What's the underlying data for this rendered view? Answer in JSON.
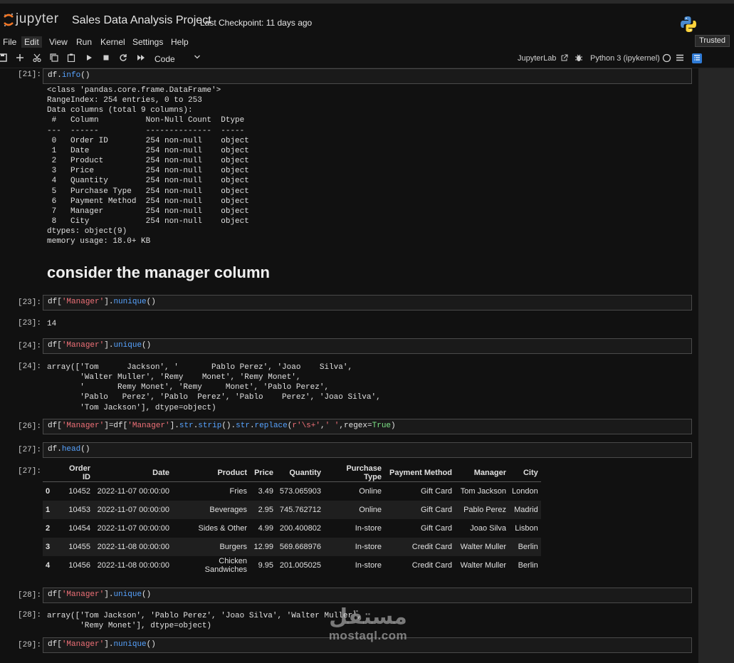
{
  "app": {
    "logo_text": "jupyter",
    "notebook_title": "Sales Data Analysis Project",
    "checkpoint": "Last Checkpoint: 11 days ago",
    "trusted": "Trusted"
  },
  "menu": [
    "File",
    "Edit",
    "View",
    "Run",
    "Kernel",
    "Settings",
    "Help"
  ],
  "toolbar": {
    "icons": [
      "save-icon",
      "add-cell-icon",
      "cut-icon",
      "copy-icon",
      "paste-icon",
      "run-icon",
      "stop-icon",
      "restart-icon",
      "run-all-icon"
    ],
    "cell_type": "Code",
    "jupyterlab_label": "JupyterLab",
    "kernel_name": "Python 3 (ipykernel)"
  },
  "cells": {
    "c21": {
      "prompt_in": "[21]:",
      "code": [
        {
          "t": "var",
          "v": "df."
        },
        {
          "t": "attr",
          "v": "info"
        },
        {
          "t": "var",
          "v": "()"
        }
      ],
      "output": "<class 'pandas.core.frame.DataFrame'>\nRangeIndex: 254 entries, 0 to 253\nData columns (total 9 columns):\n #   Column          Non-Null Count  Dtype \n---  ------          --------------  ----- \n 0   Order ID        254 non-null    object\n 1   Date            254 non-null    object\n 2   Product         254 non-null    object\n 3   Price           254 non-null    object\n 4   Quantity        254 non-null    object\n 5   Purchase Type   254 non-null    object\n 6   Payment Method  254 non-null    object\n 7   Manager         254 non-null    object\n 8   City            254 non-null    object\ndtypes: object(9)\nmemory usage: 18.0+ KB"
    },
    "markdown_heading": "consider the manager column",
    "c23": {
      "prompt_in": "[23]:",
      "prompt_out": "[23]:",
      "code": [
        {
          "t": "var",
          "v": "df["
        },
        {
          "t": "str",
          "v": "'Manager'"
        },
        {
          "t": "var",
          "v": "]."
        },
        {
          "t": "attr",
          "v": "nunique"
        },
        {
          "t": "var",
          "v": "()"
        }
      ],
      "output": "14"
    },
    "c24": {
      "prompt_in": "[24]:",
      "prompt_out": "[24]:",
      "code": [
        {
          "t": "var",
          "v": "df["
        },
        {
          "t": "str",
          "v": "'Manager'"
        },
        {
          "t": "var",
          "v": "]."
        },
        {
          "t": "attr",
          "v": "unique"
        },
        {
          "t": "var",
          "v": "()"
        }
      ],
      "output": "array(['Tom      Jackson', '       Pablo Perez', 'Joao    Silva',\n       'Walter Muller', 'Remy    Monet', 'Remy Monet',\n       '       Remy Monet', 'Remy     Monet', 'Pablo Perez',\n       'Pablo   Perez', 'Pablo  Perez', 'Pablo    Perez', 'Joao Silva',\n       'Tom Jackson'], dtype=object)"
    },
    "c26": {
      "prompt_in": "[26]:",
      "code": [
        {
          "t": "var",
          "v": "df["
        },
        {
          "t": "str",
          "v": "'Manager'"
        },
        {
          "t": "var",
          "v": "]=df["
        },
        {
          "t": "str",
          "v": "'Manager'"
        },
        {
          "t": "var",
          "v": "]."
        },
        {
          "t": "attr",
          "v": "str"
        },
        {
          "t": "var",
          "v": "."
        },
        {
          "t": "attr",
          "v": "strip"
        },
        {
          "t": "var",
          "v": "()."
        },
        {
          "t": "attr",
          "v": "str"
        },
        {
          "t": "var",
          "v": "."
        },
        {
          "t": "attr",
          "v": "replace"
        },
        {
          "t": "var",
          "v": "("
        },
        {
          "t": "str",
          "v": "r'\\s+'"
        },
        {
          "t": "var",
          "v": ","
        },
        {
          "t": "str",
          "v": "' '"
        },
        {
          "t": "var",
          "v": ",regex="
        },
        {
          "t": "kw",
          "v": "True"
        },
        {
          "t": "var",
          "v": ")"
        }
      ]
    },
    "c27": {
      "prompt_in": "[27]:",
      "prompt_out": "[27]:",
      "code": [
        {
          "t": "var",
          "v": "df."
        },
        {
          "t": "attr",
          "v": "head"
        },
        {
          "t": "var",
          "v": "()"
        }
      ],
      "table": {
        "columns": [
          "",
          "Order ID",
          "Date",
          "Product",
          "Price",
          "Quantity",
          "Purchase Type",
          "Payment Method",
          "Manager",
          "City"
        ],
        "rows": [
          [
            "0",
            "10452",
            "2022-11-07 00:00:00",
            "Fries",
            "3.49",
            "573.065903",
            "Online",
            "Gift Card",
            "Tom Jackson",
            "London"
          ],
          [
            "1",
            "10453",
            "2022-11-07 00:00:00",
            "Beverages",
            "2.95",
            "745.762712",
            "Online",
            "Gift Card",
            "Pablo Perez",
            "Madrid"
          ],
          [
            "2",
            "10454",
            "2022-11-07 00:00:00",
            "Sides & Other",
            "4.99",
            "200.400802",
            "In-store",
            "Gift Card",
            "Joao Silva",
            "Lisbon"
          ],
          [
            "3",
            "10455",
            "2022-11-08 00:00:00",
            "Burgers",
            "12.99",
            "569.668976",
            "In-store",
            "Credit Card",
            "Walter Muller",
            "Berlin"
          ],
          [
            "4",
            "10456",
            "2022-11-08 00:00:00",
            "Chicken Sandwiches",
            "9.95",
            "201.005025",
            "In-store",
            "Credit Card",
            "Walter Muller",
            "Berlin"
          ]
        ]
      }
    },
    "c28": {
      "prompt_in": "[28]:",
      "prompt_out": "[28]:",
      "code": [
        {
          "t": "var",
          "v": "df["
        },
        {
          "t": "str",
          "v": "'Manager'"
        },
        {
          "t": "var",
          "v": "]."
        },
        {
          "t": "attr",
          "v": "unique"
        },
        {
          "t": "var",
          "v": "()"
        }
      ],
      "output": "array(['Tom Jackson', 'Pablo Perez', 'Joao Silva', 'Walter Muller',\n       'Remy Monet'], dtype=object)"
    },
    "c29": {
      "prompt_in": "[29]:",
      "code": [
        {
          "t": "var",
          "v": "df["
        },
        {
          "t": "str",
          "v": "'Manager'"
        },
        {
          "t": "var",
          "v": "]."
        },
        {
          "t": "attr",
          "v": "nunique"
        },
        {
          "t": "var",
          "v": "()"
        }
      ]
    }
  },
  "watermark": {
    "arabic": "مستقل",
    "latin": "mostaql.com"
  },
  "colors": {
    "background": "#111111",
    "cell_border": "#4a4a4a",
    "string": "#f07178",
    "attribute": "#57a3ff",
    "keyword": "#7ee787"
  }
}
